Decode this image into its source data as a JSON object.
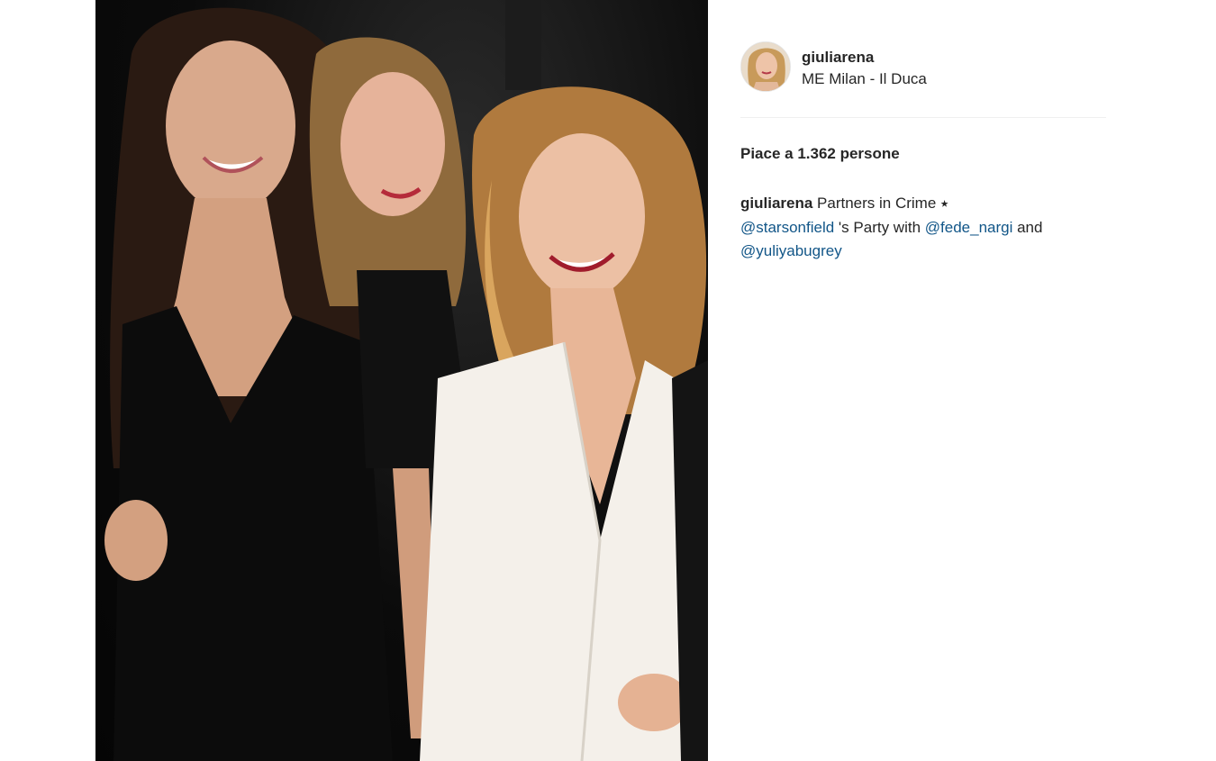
{
  "post": {
    "username": "giuliarena",
    "location": "ME Milan - Il Duca",
    "likes_text": "Piace a 1.362 persone",
    "caption": {
      "username": "giuliarena",
      "text_1": " Partners in Crime ⭑",
      "mention_1": "@starsonfield",
      "text_2": " 's Party with ",
      "mention_2": "@fede_nargi",
      "text_3": " and",
      "mention_3": "@yuliyabugrey"
    }
  },
  "colors": {
    "link": "#125688",
    "text": "#262626",
    "divider": "#efefef"
  },
  "icons": {
    "avatar": "profile-photo"
  }
}
